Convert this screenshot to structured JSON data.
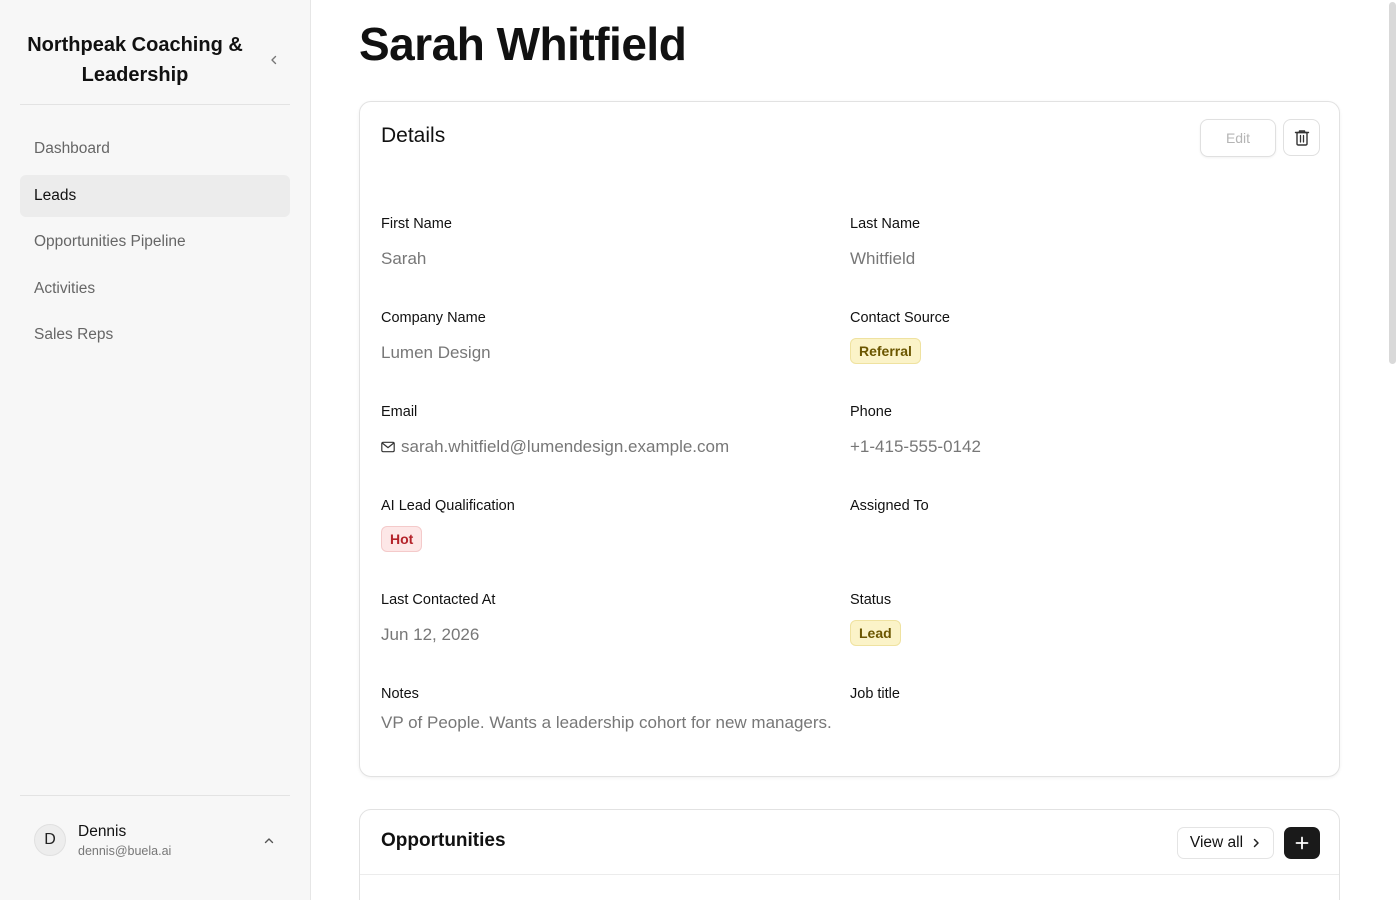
{
  "sidebar": {
    "brand": "Northpeak Coaching & Leadership",
    "nav": [
      {
        "label": "Dashboard",
        "active": false
      },
      {
        "label": "Leads",
        "active": true
      },
      {
        "label": "Opportunities Pipeline",
        "active": false
      },
      {
        "label": "Activities",
        "active": false
      },
      {
        "label": "Sales Reps",
        "active": false
      }
    ],
    "user": {
      "initial": "D",
      "name": "Dennis",
      "email": "dennis@buela.ai"
    }
  },
  "page": {
    "title": "Sarah Whitfield"
  },
  "details": {
    "title": "Details",
    "edit_label": "Edit",
    "fields": {
      "first_name": {
        "label": "First Name",
        "value": "Sarah"
      },
      "last_name": {
        "label": "Last Name",
        "value": "Whitfield"
      },
      "company": {
        "label": "Company Name",
        "value": "Lumen Design"
      },
      "contact_source": {
        "label": "Contact Source",
        "value": "Referral"
      },
      "email": {
        "label": "Email",
        "value": "sarah.whitfield@lumendesign.example.com"
      },
      "phone": {
        "label": "Phone",
        "value": "+1-415-555-0142"
      },
      "ai_qualification": {
        "label": "AI Lead Qualification",
        "value": "Hot"
      },
      "assigned_to": {
        "label": "Assigned To",
        "value": ""
      },
      "last_contacted": {
        "label": "Last Contacted At",
        "value": "Jun 12, 2026"
      },
      "status": {
        "label": "Status",
        "value": "Lead"
      },
      "notes": {
        "label": "Notes",
        "value": "VP of People. Wants a leadership cohort for new managers."
      },
      "job_title": {
        "label": "Job title",
        "value": ""
      }
    }
  },
  "opportunities": {
    "title": "Opportunities",
    "view_all_label": "View all"
  },
  "colors": {
    "badge_yellow_bg": "#fbf3c8",
    "badge_red_bg": "#fde7e7",
    "primary_button": "#1a1a1a"
  },
  "icons": {
    "collapse": "chevron-left-icon",
    "delete": "trash-icon",
    "email": "mail-icon",
    "user_toggle": "chevron-up-icon",
    "view_all": "chevron-right-icon",
    "add": "plus-icon"
  }
}
